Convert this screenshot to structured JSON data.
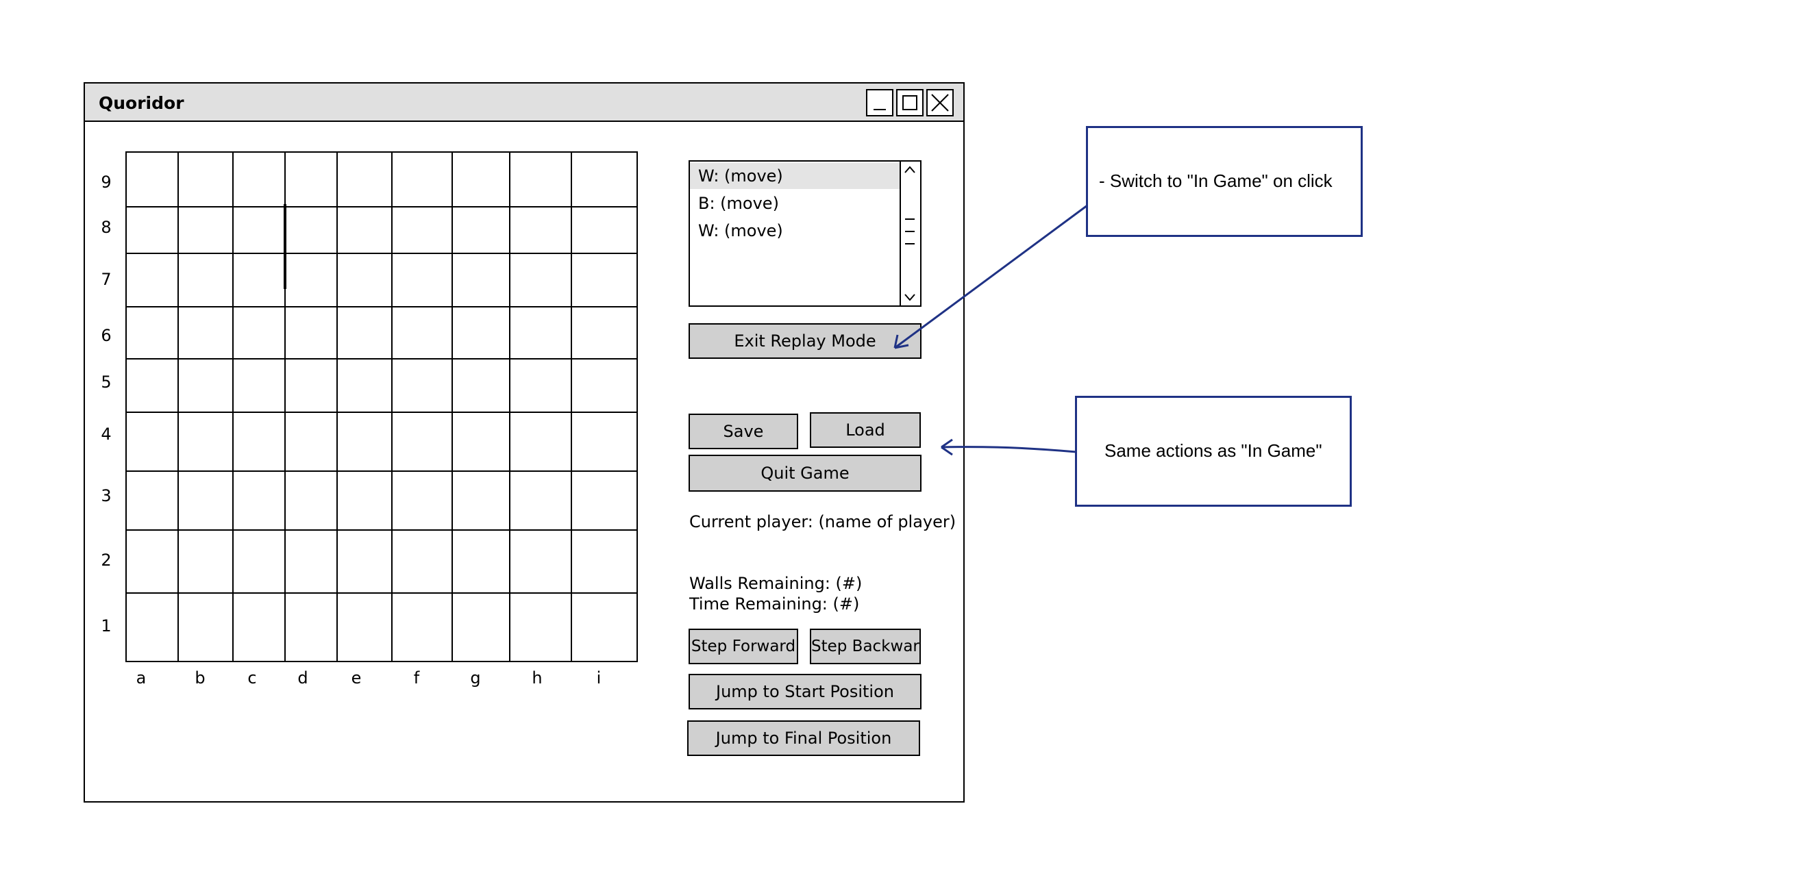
{
  "window": {
    "title": "Quoridor",
    "controls": {
      "minimize": "minimize-icon",
      "maximize": "maximize-icon",
      "close": "close-icon"
    }
  },
  "board": {
    "ranks": [
      "9",
      "8",
      "7",
      "6",
      "5",
      "4",
      "3",
      "2",
      "1"
    ],
    "files": [
      "a",
      "b",
      "c",
      "d",
      "e",
      "f",
      "g",
      "h",
      "i"
    ]
  },
  "moves": [
    "W: (move)",
    "B: (move)",
    "W: (move)"
  ],
  "buttons": {
    "exit_replay": "Exit Replay Mode",
    "save": "Save",
    "load": "Load",
    "quit": "Quit Game",
    "step_forward": "Step Forward",
    "step_backward": "Step Backward",
    "jump_start": "Jump to Start Position",
    "jump_final": "Jump to Final Position"
  },
  "status": {
    "current_player": "Current player: (name of player)",
    "walls_remaining": "Walls Remaining: (#)",
    "time_remaining": "Time Remaining: (#)"
  },
  "annotations": {
    "exit_note": "- Switch to \"In Game\" on click",
    "actions_note": "Same actions as \"In Game\""
  },
  "colors": {
    "annotation": "#1f3285",
    "button": "#d0d0d0",
    "titlebar": "#e0e0e0"
  }
}
